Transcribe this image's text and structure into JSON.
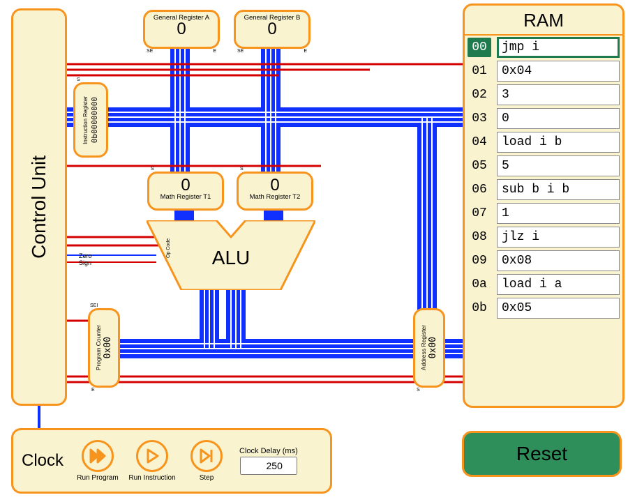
{
  "control_unit": {
    "label": "Control Unit",
    "zero_label": "Zero",
    "sign_label": "Sign"
  },
  "registers": {
    "genA": {
      "name": "General Register A",
      "value": "0"
    },
    "genB": {
      "name": "General Register B",
      "value": "0"
    },
    "instr": {
      "name": "Instruction Register",
      "value": "0b00000000"
    },
    "mathT1": {
      "name": "Math Register T1",
      "value": "0"
    },
    "mathT2": {
      "name": "Math Register T2",
      "value": "0"
    },
    "pc": {
      "name": "Program Counter",
      "value": "0x00"
    },
    "addr": {
      "name": "Address Register",
      "value": "0x00"
    }
  },
  "port_labels": {
    "s": "S",
    "se": "SE",
    "e": "E",
    "sei": "SEI"
  },
  "alu": {
    "label": "ALU",
    "opcode_label": "Op Code"
  },
  "ram": {
    "title": "RAM",
    "selected_index": 0,
    "rows": [
      {
        "addr": "00",
        "value": "jmp i"
      },
      {
        "addr": "01",
        "value": "0x04"
      },
      {
        "addr": "02",
        "value": "3"
      },
      {
        "addr": "03",
        "value": "0"
      },
      {
        "addr": "04",
        "value": "load i b"
      },
      {
        "addr": "05",
        "value": "5"
      },
      {
        "addr": "06",
        "value": "sub b i b"
      },
      {
        "addr": "07",
        "value": "1"
      },
      {
        "addr": "08",
        "value": "jlz i"
      },
      {
        "addr": "09",
        "value": "0x08"
      },
      {
        "addr": "0a",
        "value": "load i a"
      },
      {
        "addr": "0b",
        "value": "0x05"
      }
    ]
  },
  "clock": {
    "label": "Clock",
    "run_program": "Run\nProgram",
    "run_instruction": "Run\nInstruction",
    "step": "Step",
    "delay_label": "Clock Delay (ms)",
    "delay_value": "250"
  },
  "reset": {
    "label": "Reset"
  }
}
